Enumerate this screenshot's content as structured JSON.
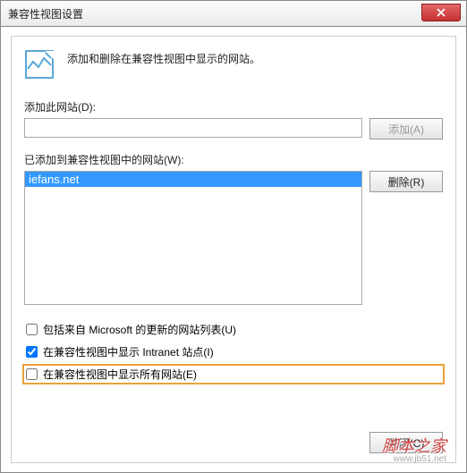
{
  "window": {
    "title": "兼容性视图设置"
  },
  "header": {
    "description": "添加和删除在兼容性视图中显示的网站。"
  },
  "add_section": {
    "label": "添加此网站(D):",
    "input_value": "",
    "button": "添加(A)"
  },
  "list_section": {
    "label": "已添加到兼容性视图中的网站(W):",
    "items": [
      "iefans.net"
    ],
    "remove_button": "删除(R)"
  },
  "checkboxes": {
    "microsoft_update": {
      "label": "包括来自 Microsoft 的更新的网站列表(U)",
      "checked": false
    },
    "intranet": {
      "label": "在兼容性视图中显示 Intranet 站点(I)",
      "checked": true
    },
    "all_sites": {
      "label": "在兼容性视图中显示所有网站(E)",
      "checked": false
    }
  },
  "footer": {
    "close_button": "关闭(C)"
  },
  "watermark": {
    "text": "脚本之家",
    "url": "www.jb51.net"
  }
}
